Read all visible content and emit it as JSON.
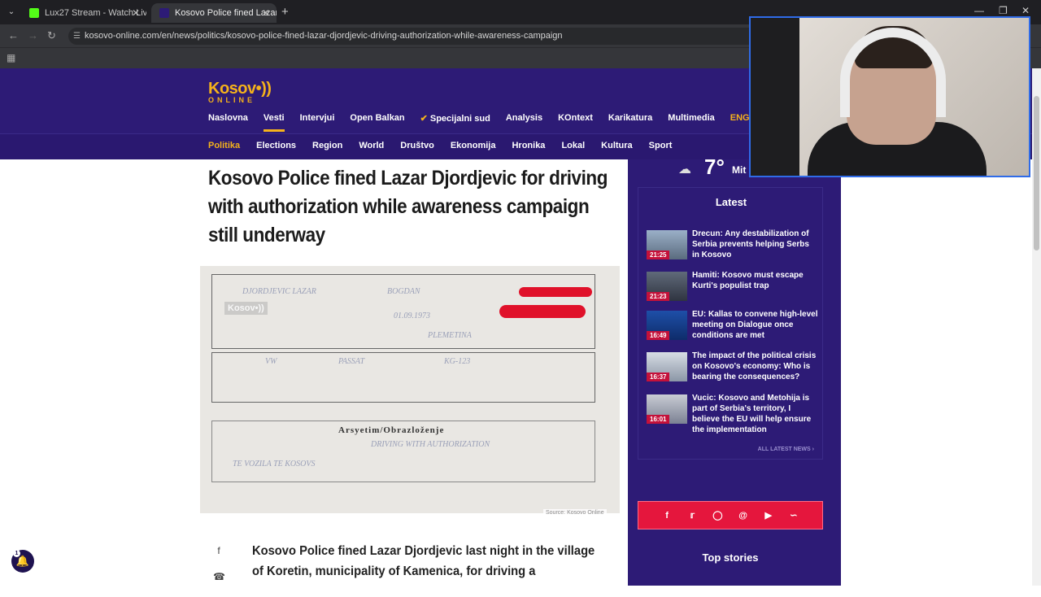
{
  "browser": {
    "tabs": [
      {
        "title": "Lux27 Stream - Watch Live on K",
        "active": false
      },
      {
        "title": "Kosovo Police fined Lazar Djord",
        "active": true
      }
    ],
    "url": "kosovo-online.com/en/news/politics/kosovo-police-fined-lazar-djordjevic-driving-authorization-while-awareness-campaign"
  },
  "site": {
    "logo": "Kosov•))",
    "logo_sub": "ONLINE",
    "main_nav": [
      "Naslovna",
      "Vesti",
      "Intervjui",
      "Open Balkan",
      "Specijalni sud",
      "Analysis",
      "KOntext",
      "Karikatura",
      "Multimedia",
      "ENGLISH"
    ],
    "active_main": "Vesti",
    "sub_nav": [
      "Politika",
      "Elections",
      "Region",
      "World",
      "Društvo",
      "Ekonomija",
      "Hronika",
      "Lokal",
      "Kultura",
      "Sport"
    ],
    "active_sub": "Politika",
    "accent_color": "#f5b21b",
    "brand_color": "#2d1b76"
  },
  "article": {
    "headline": "Kosovo Police fined Lazar Djordjevic for driving with authorization while awareness campaign still underway",
    "photo_watermark": "Kosov•))",
    "photo_title": "Arsyetim/Obrazloženje",
    "photo_source": "Source: Kosovo Online",
    "lead": "Kosovo Police fined Lazar Djordjevic last night in the village of Koretin, municipality of Kamenica, for driving a"
  },
  "sidebar": {
    "weather": {
      "temp": "7°",
      "city": "Mit"
    },
    "latest_title": "Latest",
    "latest": [
      {
        "time": "21:25",
        "title": "Drecun: Any destabilization of Serbia prevents helping Serbs in Kosovo"
      },
      {
        "time": "21:23",
        "title": "Hamiti: Kosovo must escape Kurti's populist trap"
      },
      {
        "time": "16:49",
        "title": "EU: Kallas to convene high-level meeting on Dialogue once conditions are met"
      },
      {
        "time": "16:37",
        "title": "The impact of the political crisis on Kosovo's economy: Who is bearing the consequences?"
      },
      {
        "time": "16:01",
        "title": "Vucic: Kosovo and Metohija is part of Serbia's territory, I believe the EU will help ensure the implementation"
      }
    ],
    "all_news": "ALL LATEST NEWS ›",
    "social_icons": [
      "facebook-icon",
      "twitter-icon",
      "instagram-icon",
      "threads-icon",
      "youtube-icon",
      "rss-icon"
    ],
    "social_color": "#e5163d",
    "top_stories": "Top stories"
  },
  "notifications": {
    "count": "1"
  }
}
